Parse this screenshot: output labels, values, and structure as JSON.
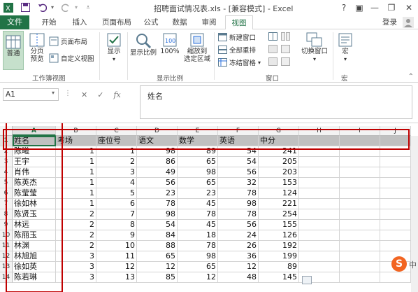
{
  "window": {
    "title": "招聘面试情况表.xls - [兼容模式] - Excel",
    "controls": [
      "?",
      "▣",
      "—",
      "❐",
      "✕"
    ]
  },
  "tabs": {
    "file": "文件",
    "items": [
      "开始",
      "插入",
      "页面布局",
      "公式",
      "数据",
      "审阅",
      "视图"
    ],
    "active": "视图",
    "login": "登录"
  },
  "ribbon": {
    "normal": "普通",
    "page_break": "分页\n预览",
    "page_layout": "页面布局",
    "custom_view": "自定义视图",
    "show": "显示",
    "zoom": "显示比例",
    "zoom100": "100%",
    "zoom_selection": "缩放到\n选定区域",
    "new_window": "新建窗口",
    "arrange_all": "全部重排",
    "freeze": "冻结窗格",
    "switch_window": "切换窗口",
    "macro": "宏",
    "group_workbook_views": "工作簿视图",
    "group_zoom": "显示比例",
    "group_window": "窗口",
    "group_macro": "宏"
  },
  "formula_bar": {
    "name_box": "A1",
    "fx": "fx",
    "content": "姓名"
  },
  "grid": {
    "columns": [
      "A",
      "B",
      "C",
      "D",
      "E",
      "F",
      "G",
      "H",
      "I",
      "J"
    ],
    "selected_column": "A",
    "header_row": [
      "姓名",
      "考场",
      "座位号",
      "语文",
      "数学",
      "英语",
      "中分"
    ],
    "rows": [
      [
        "陈曦",
        "1",
        "1",
        "98",
        "89",
        "54",
        "241"
      ],
      [
        "王宇",
        "1",
        "2",
        "86",
        "65",
        "54",
        "205"
      ],
      [
        "肖伟",
        "1",
        "3",
        "49",
        "98",
        "56",
        "203"
      ],
      [
        "陈英杰",
        "1",
        "4",
        "56",
        "65",
        "32",
        "153"
      ],
      [
        "陈莹莹",
        "1",
        "5",
        "23",
        "23",
        "78",
        "124"
      ],
      [
        "徐如林",
        "1",
        "6",
        "78",
        "45",
        "98",
        "221"
      ],
      [
        "陈贤玉",
        "2",
        "7",
        "98",
        "78",
        "78",
        "254"
      ],
      [
        "林远",
        "2",
        "8",
        "54",
        "45",
        "56",
        "155"
      ],
      [
        "陈丽玉",
        "2",
        "9",
        "84",
        "18",
        "24",
        "126"
      ],
      [
        "林渊",
        "2",
        "10",
        "88",
        "78",
        "26",
        "192"
      ],
      [
        "林旭旭",
        "3",
        "11",
        "65",
        "98",
        "36",
        "199"
      ],
      [
        "徐如英",
        "3",
        "12",
        "12",
        "65",
        "12",
        "89"
      ],
      [
        "陈若琳",
        "3",
        "13",
        "85",
        "12",
        "48",
        "145"
      ]
    ],
    "row_numbers": [
      "1",
      "2",
      "3",
      "4",
      "5",
      "6",
      "7",
      "8",
      "9",
      "10",
      "11",
      "12",
      "13",
      "14"
    ]
  },
  "ime": {
    "logo": "S",
    "mode": "中"
  },
  "colors": {
    "accent": "#217346",
    "annotation": "#c00000",
    "header_fill": "#c0c0c0"
  }
}
